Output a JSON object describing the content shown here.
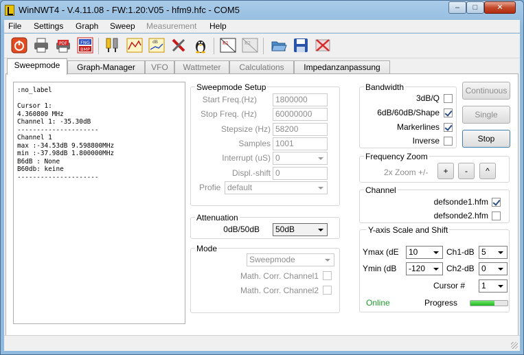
{
  "window": {
    "title": "WinNWT4 - V.4.11.08 - FW:1.20:V05 - hfm9.hfc - COM5",
    "minimize": "‒",
    "maximize": "□",
    "close": "✕"
  },
  "menu": [
    "File",
    "Settings",
    "Graph",
    "Sweep",
    "Measurement",
    "Help"
  ],
  "toolbar_icons": [
    "power-icon",
    "printer-icon",
    "print-pdf-icon",
    "fng-bmp-icon",
    "probe-icon",
    "graph-icon",
    "db-icon",
    "tools-icon",
    "linux-icon",
    "k1-icon",
    "k2-icon",
    "open-folder-icon",
    "save-icon",
    "delete-icon"
  ],
  "toolbar_labels": {
    "pdf": "PDF",
    "fng": "FNG",
    "bmp": "BMP",
    "db": "dB",
    "k1": "K1",
    "k2": "K2"
  },
  "tabs": [
    {
      "label": "Sweepmode",
      "active": true
    },
    {
      "label": "Graph-Manager",
      "active": false
    },
    {
      "label": "VFO",
      "active": false
    },
    {
      "label": "Wattmeter",
      "active": false
    },
    {
      "label": "Calculations",
      "active": false
    },
    {
      "label": "Impedanzanpassung",
      "active": false
    }
  ],
  "log_text": ":no_label\n\nCursor 1:\n4.360800 MHz\nChannel 1: -35.30dB\n---------------------\nChannel 1\nmax :-34.53dB 9.598800MHz\nmin :-37.98dB 1.800000MHz\nB6dB : None\nB60db: keine\n---------------------",
  "sweepmode_setup": {
    "title": "Sweepmode Setup",
    "start_freq_label": "Start Freq.(Hz)",
    "start_freq": "1800000",
    "stop_freq_label": "Stop Freq. (Hz)",
    "stop_freq": "60000000",
    "stepsize_label": "Stepsize (Hz)",
    "stepsize": "58200",
    "samples_label": "Samples",
    "samples": "1001",
    "interrupt_label": "Interrupt (uS)",
    "interrupt": "0",
    "displ_shift_label": "Displ.-shift",
    "displ_shift": "0",
    "profile_label": "Profie",
    "profile": "default"
  },
  "attenuation": {
    "title": "Attenuation",
    "label": "0dB/50dB",
    "value": "50dB"
  },
  "mode": {
    "title": "Mode",
    "value": "Sweepmode",
    "math_corr_1": "Math. Corr. Channel1",
    "math_corr_2": "Math. Corr. Channel2"
  },
  "bandwidth": {
    "title": "Bandwidth",
    "items": [
      {
        "label": "3dB/Q",
        "checked": false
      },
      {
        "label": "6dB/60dB/Shape",
        "checked": true
      },
      {
        "label": "Markerlines",
        "checked": true
      },
      {
        "label": "Inverse",
        "checked": false
      }
    ]
  },
  "buttons": {
    "continuous": "Continuous",
    "single": "Single",
    "stop": "Stop"
  },
  "frequency_zoom": {
    "title": "Frequency Zoom",
    "label": "2x Zoom +/-",
    "plus": "+",
    "minus": "-",
    "up": "^"
  },
  "channel": {
    "title": "Channel",
    "items": [
      {
        "label": "defsonde1.hfm",
        "checked": true
      },
      {
        "label": "defsonde2.hfm",
        "checked": false
      }
    ]
  },
  "y_axis": {
    "title": "Y-axis Scale and Shift",
    "ymax_label": "Ymax (dE",
    "ymax": "10",
    "ymin_label": "Ymin (dB",
    "ymin": "-120",
    "ch1_label": "Ch1-dB",
    "ch1": "5",
    "ch2_label": "Ch2-dB",
    "ch2": "0",
    "cursor_label": "Cursor #",
    "cursor": "1",
    "online": "Online",
    "progress_label": "Progress",
    "progress": 0.65
  },
  "colors": {
    "online": "#1e9a2c",
    "progress": "#21b521",
    "accent": "#3c7fb1"
  }
}
